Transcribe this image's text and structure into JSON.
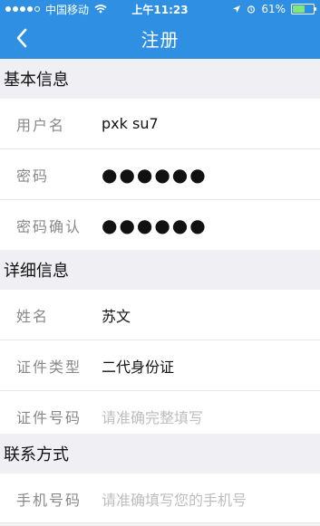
{
  "status_bar": {
    "carrier": "中国移动",
    "time": "上午11:23",
    "battery": "61%",
    "battery_level": 0.61
  },
  "nav": {
    "title": "注册",
    "back_icon": "chevron-left-icon"
  },
  "sections": [
    {
      "title": "基本信息",
      "rows": [
        {
          "label": "用户名",
          "value": "pxk  su7"
        },
        {
          "label": "密码",
          "value": "●●●●●●"
        },
        {
          "label": "密码确认",
          "value": "●●●●●●"
        }
      ]
    },
    {
      "title": "详细信息",
      "rows": [
        {
          "label": "姓名",
          "value": "苏文"
        },
        {
          "label": "证件类型",
          "value": "二代身份证"
        },
        {
          "label": "证件号码",
          "placeholder": "请准确完整填写"
        }
      ]
    },
    {
      "title": "联系方式",
      "rows": [
        {
          "label": "手机号码",
          "placeholder": "请准确填写您的手机号"
        }
      ]
    }
  ]
}
